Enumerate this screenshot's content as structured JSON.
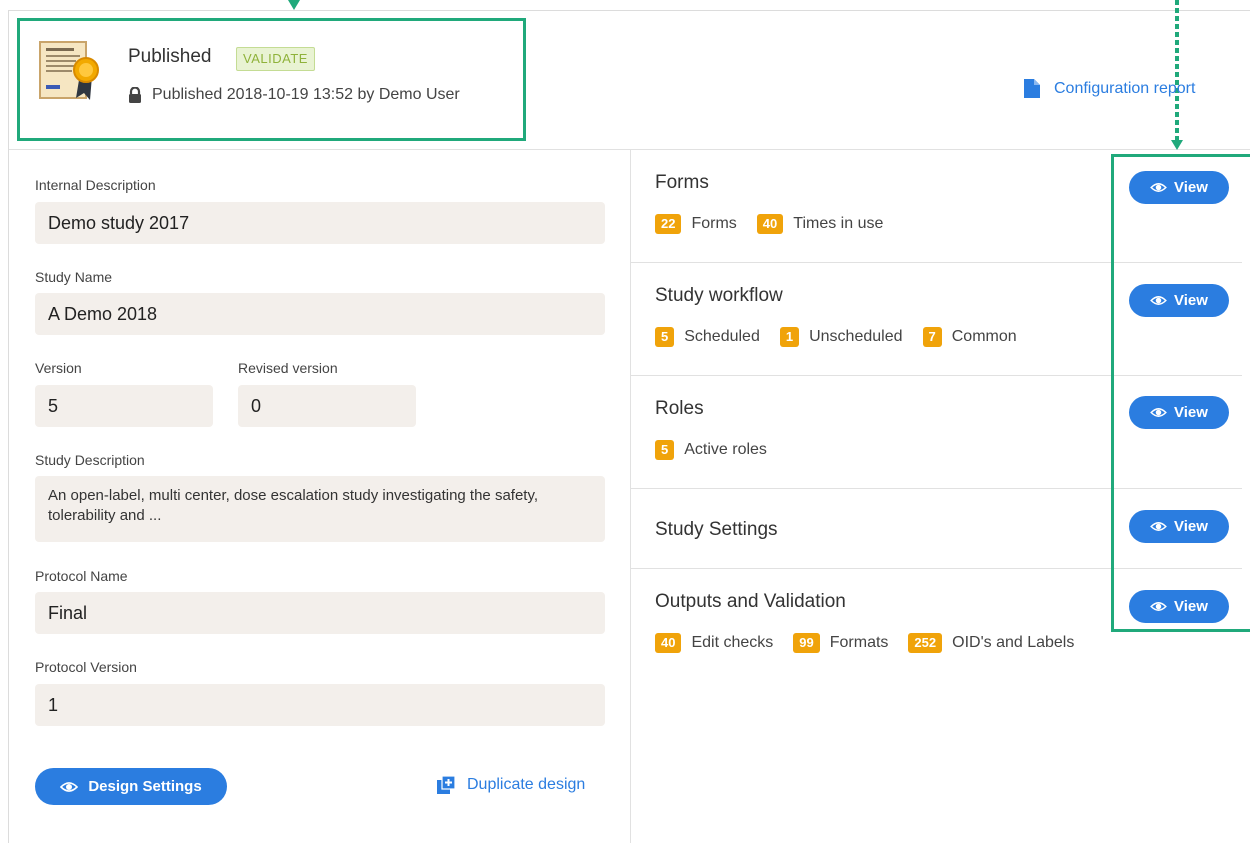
{
  "header": {
    "title": "Published",
    "badge": "VALIDATE",
    "published_info": "Published 2018-10-19 13:52 by Demo User",
    "config_report": "Configuration report"
  },
  "left": {
    "internal_description_label": "Internal Description",
    "internal_description_value": "Demo study 2017",
    "study_name_label": "Study Name",
    "study_name_value": "A Demo 2018",
    "version_label": "Version",
    "version_value": "5",
    "revised_version_label": "Revised version",
    "revised_version_value": "0",
    "study_description_label": "Study Description",
    "study_description_value": "An open-label, multi center, dose escalation study investigating the safety, tolerability and ...",
    "protocol_name_label": "Protocol Name",
    "protocol_name_value": "Final",
    "protocol_version_label": "Protocol Version",
    "protocol_version_value": "1",
    "design_settings_label": "Design Settings",
    "duplicate_design_label": "Duplicate design"
  },
  "sections": {
    "forms": {
      "title": "Forms",
      "stats": [
        {
          "count": "22",
          "label": "Forms"
        },
        {
          "count": "40",
          "label": "Times in use"
        }
      ]
    },
    "workflow": {
      "title": "Study workflow",
      "stats": [
        {
          "count": "5",
          "label": "Scheduled"
        },
        {
          "count": "1",
          "label": "Unscheduled"
        },
        {
          "count": "7",
          "label": "Common"
        }
      ]
    },
    "roles": {
      "title": "Roles",
      "stats": [
        {
          "count": "5",
          "label": "Active roles"
        }
      ]
    },
    "settings": {
      "title": "Study Settings"
    },
    "outputs": {
      "title": "Outputs and Validation",
      "stats": [
        {
          "count": "40",
          "label": "Edit checks"
        },
        {
          "count": "99",
          "label": "Formats"
        },
        {
          "count": "252",
          "label": "OID's and Labels"
        }
      ]
    }
  },
  "view_label": "View",
  "colors": {
    "accent_blue": "#2b7de0",
    "badge_orange": "#f0a30a",
    "highlight_green": "#20a97b",
    "field_bg": "#f3efeb"
  },
  "icons": {
    "certificate": "certificate-icon",
    "lock": "lock-icon",
    "document": "document-icon",
    "eye": "eye-icon",
    "duplicate": "duplicate-icon"
  }
}
